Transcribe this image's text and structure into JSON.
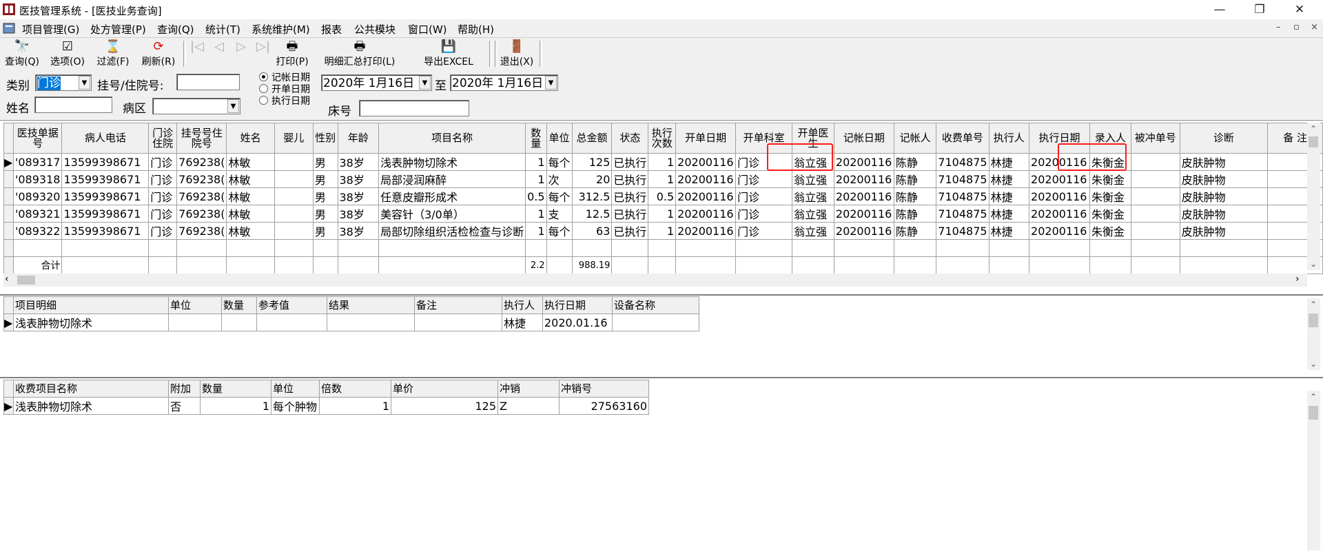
{
  "window": {
    "title": "医技管理系统 - [医技业务查询]",
    "controls": [
      "—",
      "❐",
      "✕"
    ],
    "mdi_controls": [
      "–",
      "▫",
      "×"
    ]
  },
  "menu": [
    "项目管理(G)",
    "处方管理(P)",
    "查询(Q)",
    "统计(T)",
    "系统维护(M)",
    "报表",
    "公共模块",
    "窗口(W)",
    "帮助(H)"
  ],
  "toolbar": {
    "buttons": [
      {
        "label": "查询(Q)",
        "icon": "binoculars-icon",
        "glyph": "🔭"
      },
      {
        "label": "选项(O)",
        "icon": "options-icon",
        "glyph": "☑"
      },
      {
        "label": "过滤(F)",
        "icon": "hourglass-filter-icon",
        "glyph": "⌛"
      },
      {
        "label": "刷新(R)",
        "icon": "refresh-icon",
        "glyph": "⟳"
      }
    ],
    "nav": [
      "|◁",
      "◁",
      "▷",
      "▷|"
    ],
    "buttons2": [
      {
        "label": "打印(P)",
        "icon": "printer-icon",
        "glyph": "🖶"
      },
      {
        "label": "明细汇总打印(L)",
        "icon": "printer-icon",
        "glyph": "🖶"
      },
      {
        "label": "导出EXCEL",
        "icon": "save-disk-icon",
        "glyph": "💾"
      },
      {
        "label": "退出(X)",
        "icon": "exit-door-icon",
        "glyph": "🚪"
      }
    ]
  },
  "filter": {
    "category_label": "类别",
    "category_value": "门诊",
    "regno_label": "挂号/住院号:",
    "regno_value": "",
    "name_label": "姓名",
    "name_value": "",
    "ward_label": "病区",
    "ward_value": "",
    "date_options": [
      "记帐日期",
      "开单日期",
      "执行日期"
    ],
    "date_selected": 0,
    "date_from": "2020年 1月16日",
    "to_label": "至",
    "date_to": "2020年 1月16日",
    "bed_label": "床号",
    "bed_value": ""
  },
  "main_grid": {
    "columns": [
      "医技单据号",
      "病人电话",
      "门诊住院",
      "挂号号住院号",
      "姓名",
      "婴儿",
      "性别",
      "年龄",
      "项目名称",
      "数量",
      "单位",
      "总金额",
      "状态",
      "执行次数",
      "开单日期",
      "开单科室",
      "开单医生",
      "记帐日期",
      "记帐人",
      "收费单号",
      "执行人",
      "执行日期",
      "录入人",
      "被冲单号",
      "诊断",
      "备 注"
    ],
    "rows": [
      [
        "'089317",
        "13599398671",
        "门诊",
        "769238(",
        "林敏",
        "",
        "男",
        "38岁",
        "浅表肿物切除术",
        "1",
        "每个",
        "125",
        "已执行",
        "1",
        "20200116",
        "门诊",
        "翁立强",
        "20200116",
        "陈静",
        "7104875",
        "林捷",
        "20200116",
        "朱衡金",
        "",
        "皮肤肿物",
        ""
      ],
      [
        "'089318",
        "13599398671",
        "门诊",
        "769238(",
        "林敏",
        "",
        "男",
        "38岁",
        "局部浸润麻醉",
        "1",
        "次",
        "20",
        "已执行",
        "1",
        "20200116",
        "门诊",
        "翁立强",
        "20200116",
        "陈静",
        "7104875",
        "林捷",
        "20200116",
        "朱衡金",
        "",
        "皮肤肿物",
        ""
      ],
      [
        "'089320",
        "13599398671",
        "门诊",
        "769238(",
        "林敏",
        "",
        "男",
        "38岁",
        "任意皮瓣形成术",
        "0.5",
        "每个",
        "312.5",
        "已执行",
        "0.5",
        "20200116",
        "门诊",
        "翁立强",
        "20200116",
        "陈静",
        "7104875",
        "林捷",
        "20200116",
        "朱衡金",
        "",
        "皮肤肿物",
        ""
      ],
      [
        "'089321",
        "13599398671",
        "门诊",
        "769238(",
        "林敏",
        "",
        "男",
        "38岁",
        "美容针（3/0单）",
        "1",
        "支",
        "12.5",
        "已执行",
        "1",
        "20200116",
        "门诊",
        "翁立强",
        "20200116",
        "陈静",
        "7104875",
        "林捷",
        "20200116",
        "朱衡金",
        "",
        "皮肤肿物",
        ""
      ],
      [
        "'089322",
        "13599398671",
        "门诊",
        "769238(",
        "林敏",
        "",
        "男",
        "38岁",
        "局部切除组织活检检查与诊断",
        "1",
        "每个",
        "63",
        "已执行",
        "1",
        "20200116",
        "门诊",
        "翁立强",
        "20200116",
        "陈静",
        "7104875",
        "林捷",
        "20200116",
        "朱衡金",
        "",
        "皮肤肿物",
        ""
      ]
    ],
    "total_label": "合计",
    "total_qty": "2.2",
    "total_amount": "988.19"
  },
  "detail_grid": {
    "columns": [
      "项目明细",
      "单位",
      "数量",
      "参考值",
      "结果",
      "备注",
      "执行人",
      "执行日期",
      "设备名称"
    ],
    "rows": [
      [
        "浅表肿物切除术",
        "",
        "",
        "",
        "",
        "",
        "林捷",
        "2020.01.16",
        ""
      ]
    ]
  },
  "charge_grid": {
    "columns": [
      "收费项目名称",
      "附加",
      "数量",
      "单位",
      "倍数",
      "单价",
      "冲销",
      "冲销号"
    ],
    "rows": [
      [
        "浅表肿物切除术",
        "否",
        "1",
        "每个肿物",
        "1",
        "125",
        "Z",
        "27563160"
      ]
    ]
  },
  "colors": {
    "highlight": "#ff1a1a",
    "selection": "#0078d7",
    "chrome": "#f0f0f0"
  }
}
